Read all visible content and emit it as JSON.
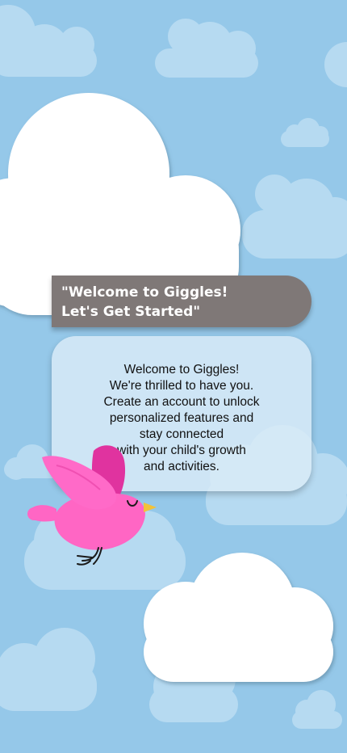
{
  "theme": {
    "sky_color": "#95c8e9",
    "banner_color": "#7f7877",
    "bird_pink": "#ff66c4",
    "bird_wing": "#e0339f",
    "beak": "#f2c23a"
  },
  "welcome": {
    "title_line1": "\"Welcome to Giggles!",
    "title_line2": "Let's Get Started\""
  },
  "message": {
    "lines": [
      "Welcome to Giggles!",
      "We're thrilled to have you.",
      "Create an account to unlock",
      "personalized features and",
      "stay connected",
      "with your child's growth",
      "and activities."
    ]
  },
  "decorations": {
    "mascot": "pink-bird-icon",
    "background": "cloud-icon"
  }
}
